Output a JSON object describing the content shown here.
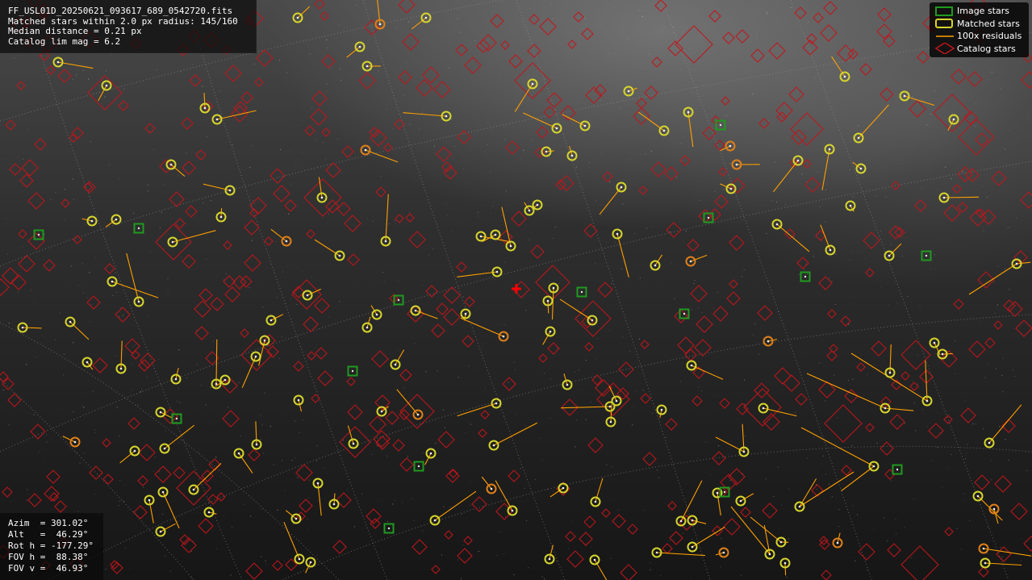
{
  "info": {
    "filename": "FF_USL01D_20250621_093617_689_0542720.fits",
    "matched": "Matched stars within 2.0 px radius: 145/160",
    "median": "Median distance = 0.21 px",
    "catalog": "Catalog lim mag = 6.2"
  },
  "pointing": {
    "azim": "Azim  = 301.02°",
    "alt": "Alt   =  46.29°",
    "rot": "Rot h = -177.29°",
    "fov_h": "FOV h =  88.38°",
    "fov_v": "FOV v =  46.93°"
  },
  "legend": {
    "image_stars": "Image stars",
    "matched_stars": "Matched stars",
    "residuals": "100x residuals",
    "catalog_stars": "Catalog stars"
  },
  "colors": {
    "image_star": "#1f9a1f",
    "matched_star": "#d6d52e",
    "residual": "#ffa000",
    "catalog_star": "#c0161c",
    "grid": "#9a9a9a",
    "center_marker": "#ff0000"
  },
  "icons": {
    "center_marker": "red-plus-icon"
  }
}
